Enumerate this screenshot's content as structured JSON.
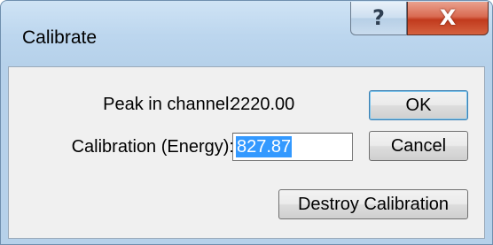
{
  "window": {
    "title": "Calibrate",
    "help_glyph": "?",
    "close_glyph": "X"
  },
  "form": {
    "peak_label": "Peak in channel:",
    "peak_value": "2220.00",
    "calibration_label": "Calibration (Energy):",
    "calibration_value": "827.87"
  },
  "buttons": {
    "ok": "OK",
    "cancel": "Cancel",
    "destroy": "Destroy Calibration"
  },
  "icons": {
    "help": "help-icon",
    "close": "close-icon"
  },
  "colors": {
    "selection": "#3399ff",
    "close_button": "#c13a1d",
    "title_bar": "#bcd6ee",
    "client_bg": "#f0f0f0"
  }
}
